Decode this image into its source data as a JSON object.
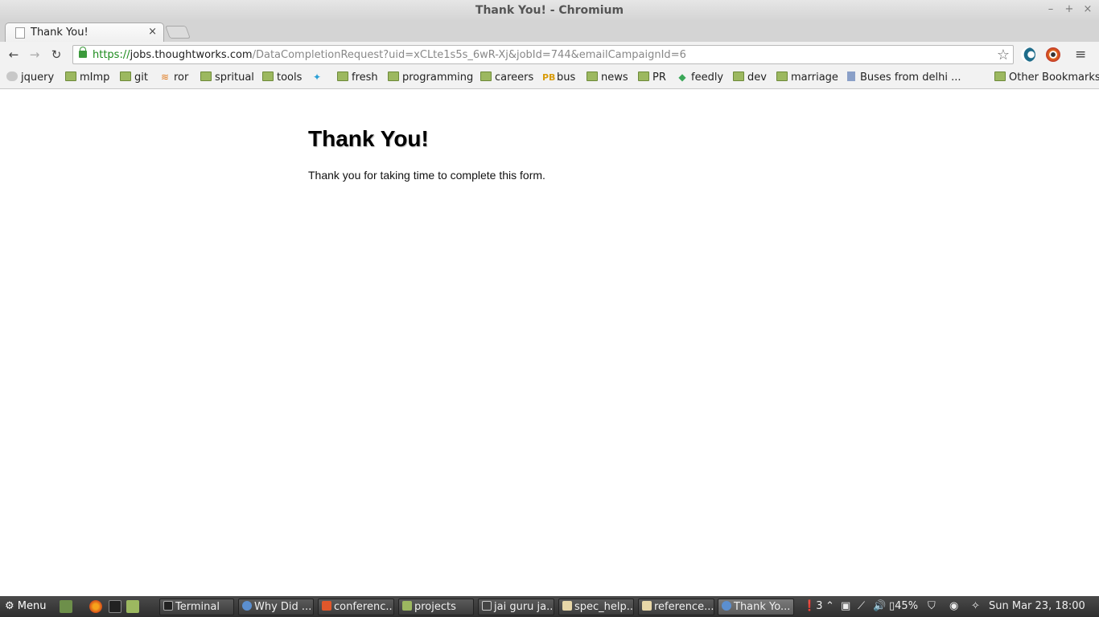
{
  "window": {
    "title": "Thank You! - Chromium",
    "minimize_glyph": "–",
    "maximize_glyph": "+",
    "close_glyph": "×"
  },
  "tabs": [
    {
      "title": "Thank You!",
      "close_glyph": "×",
      "active": true
    }
  ],
  "toolbar": {
    "back_glyph": "←",
    "forward_glyph": "→",
    "reload_glyph": "↻",
    "url_scheme": "https://",
    "url_host": "jobs.thoughtworks.com",
    "url_path": "/DataCompletionRequest?uid=xCLte1s5s_6wR-Xj&jobId=744&emailCampaignId=6",
    "star_glyph": "☆",
    "menu_glyph": "≡",
    "extension_icons": [
      "radar-extension-icon",
      "eye-extension-icon"
    ]
  },
  "bookmarks": {
    "items": [
      {
        "label": "jquery",
        "icon": "jquery-icon"
      },
      {
        "label": "mImp",
        "icon": "folder-icon"
      },
      {
        "label": "git",
        "icon": "folder-icon"
      },
      {
        "label": "ror",
        "icon": "stackoverflow-icon"
      },
      {
        "label": "spritual",
        "icon": "folder-icon"
      },
      {
        "label": "tools",
        "icon": "folder-icon"
      },
      {
        "label": "",
        "icon": "twitter-icon"
      },
      {
        "label": "fresh",
        "icon": "folder-icon"
      },
      {
        "label": "programming",
        "icon": "folder-icon"
      },
      {
        "label": "careers",
        "icon": "folder-icon"
      },
      {
        "label": "bus",
        "icon": "pb-icon"
      },
      {
        "label": "news",
        "icon": "folder-icon"
      },
      {
        "label": "PR",
        "icon": "folder-icon"
      },
      {
        "label": "feedly",
        "icon": "feedly-icon"
      },
      {
        "label": "dev",
        "icon": "folder-icon"
      },
      {
        "label": "marriage",
        "icon": "folder-icon"
      },
      {
        "label": "Buses from delhi ...",
        "icon": "page-icon"
      }
    ],
    "other": "Other Bookmarks"
  },
  "page": {
    "heading": "Thank You!",
    "message": "Thank you for taking time to complete this form."
  },
  "taskbar": {
    "menu_label": "Menu",
    "tasks": [
      {
        "label": "Terminal",
        "icon": "terminal-icon",
        "active": false
      },
      {
        "label": "Why Did ...",
        "icon": "chromium-icon",
        "active": false
      },
      {
        "label": "conferenc...",
        "icon": "app-icon",
        "active": false
      },
      {
        "label": "projects",
        "icon": "folder-icon",
        "active": false
      },
      {
        "label": "jai guru ja...",
        "icon": "media-icon",
        "active": false
      },
      {
        "label": "spec_help...",
        "icon": "text-editor-icon",
        "active": false
      },
      {
        "label": "reference...",
        "icon": "text-editor-icon",
        "active": false
      },
      {
        "label": "Thank Yo...",
        "icon": "chromium-icon",
        "active": true
      }
    ],
    "notification_count": "3",
    "battery": "45%",
    "clock": "Sun Mar 23, 18:00"
  },
  "colors": {
    "url_scheme": "#1b8a1b",
    "folder": "#9cb860",
    "taskbar_bg": "#3a3a3a"
  }
}
